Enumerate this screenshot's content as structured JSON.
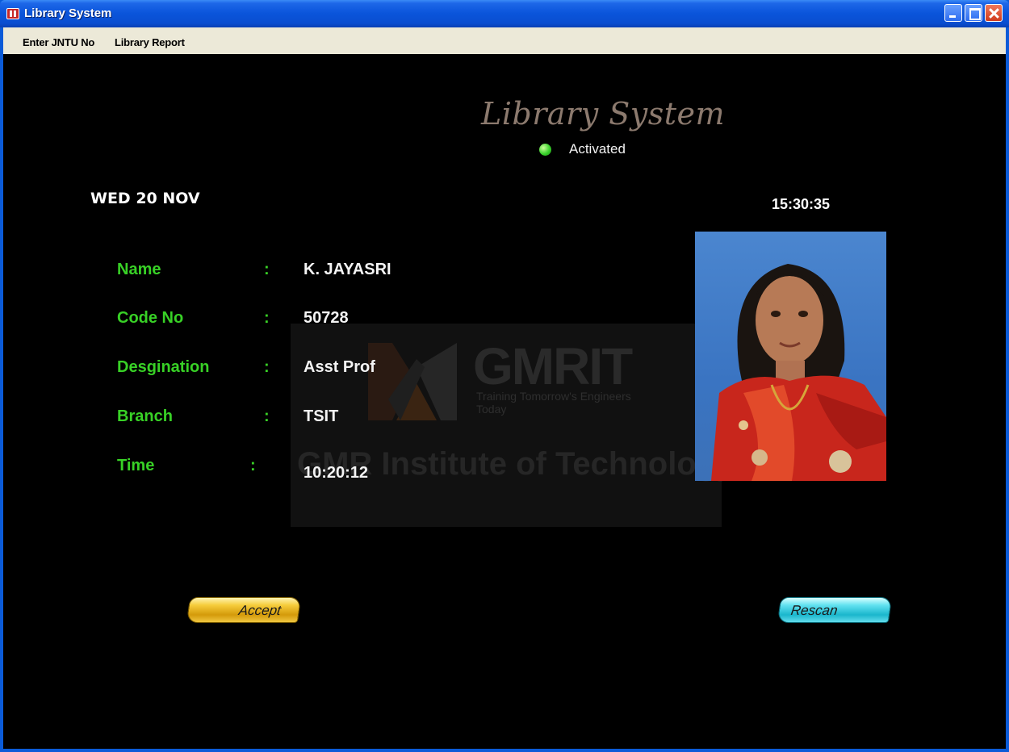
{
  "window": {
    "title": "Library System"
  },
  "menu": {
    "items": [
      "Enter JNTU No",
      "Library Report"
    ]
  },
  "header": {
    "app_title": "Library System",
    "status": "Activated",
    "status_color": "#39d22c"
  },
  "date": "WED 20 NOV",
  "clock": "15:30:35",
  "fields": [
    {
      "label": "Name",
      "colon": ":",
      "value": "K. JAYASRI"
    },
    {
      "label": "Code No",
      "colon": ":",
      "value": "50728"
    },
    {
      "label": "Desgination",
      "colon": ":",
      "value": "Asst Prof"
    },
    {
      "label": "Branch",
      "colon": ":",
      "value": "TSIT"
    },
    {
      "label": "Time",
      "colon": ":",
      "value": "10:20:12"
    }
  ],
  "watermark": {
    "brand": "GMRIT",
    "tagline": "Training Tomorrow's Engineers Today",
    "institute": "GMR Institute of Technology"
  },
  "buttons": {
    "accept": "Accept",
    "rescan": "Rescan"
  },
  "colors": {
    "label_green": "#38d126",
    "accept_gold": "#f6cd3c",
    "rescan_cyan": "#1ab6cc",
    "background": "#000000"
  }
}
